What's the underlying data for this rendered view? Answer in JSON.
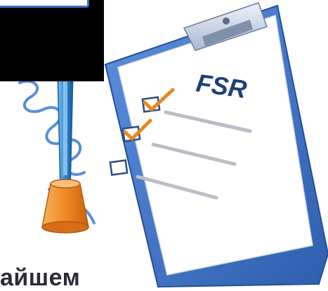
{
  "clipboard": {
    "heading": "FSR",
    "checklist": [
      {
        "checked": true
      },
      {
        "checked": true
      },
      {
        "checked": false
      }
    ]
  },
  "caption": {
    "text": "айшем"
  },
  "colors": {
    "clipboard_blue": "#3f6fbf",
    "check_orange": "#e8891d",
    "pen_blue": "#2f86cf",
    "holder_orange": "#f08a24"
  }
}
